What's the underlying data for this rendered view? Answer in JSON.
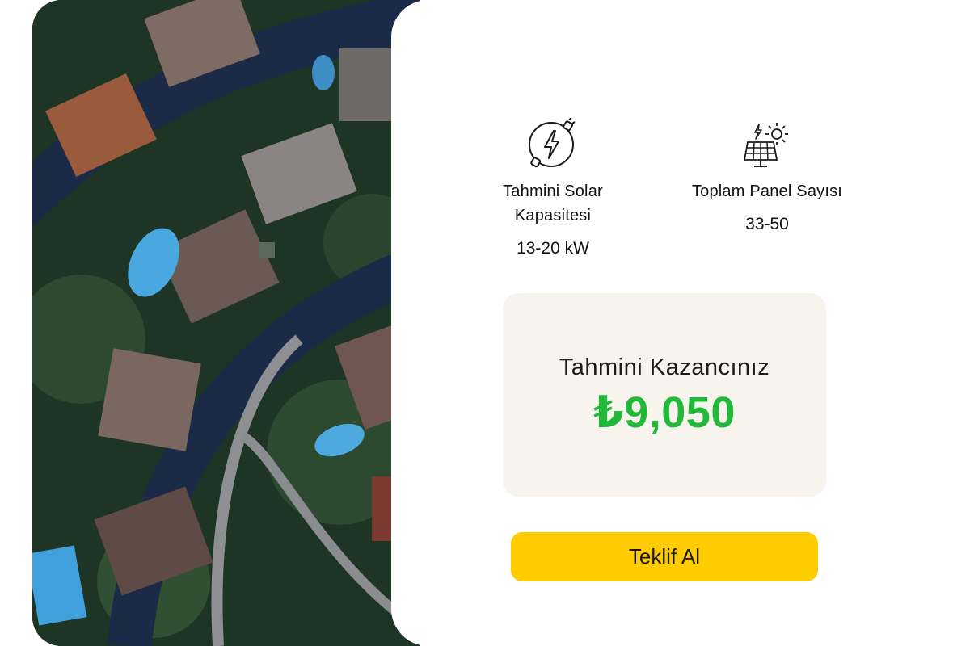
{
  "stats": {
    "capacity": {
      "label": "Tahmini Solar Kapasitesi",
      "value": "13-20 kW",
      "icon": "lightning-plug-icon"
    },
    "panels": {
      "label": "Toplam Panel Sayısı",
      "value": "33-50",
      "icon": "solar-panel-sun-icon"
    }
  },
  "earnings": {
    "title": "Tahmini Kazancınız",
    "value": "₺9,050"
  },
  "cta": {
    "label": "Teklif Al"
  },
  "colors": {
    "accent_yellow": "#ffcc00",
    "earnings_green": "#22b83a",
    "earnings_bg": "#f6f4ec"
  }
}
